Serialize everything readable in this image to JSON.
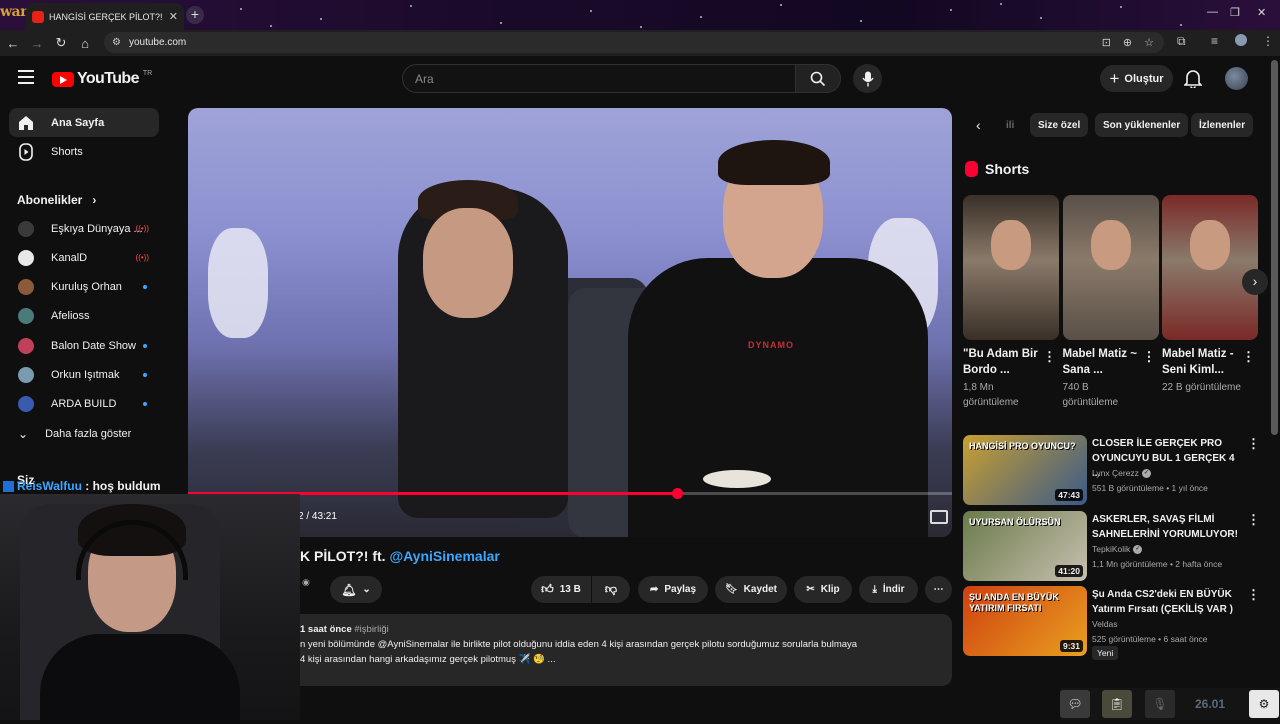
{
  "browser": {
    "tab_title": "HANGİSİ GERÇEK PİLOT?! ft. @A",
    "url": "youtube.com",
    "overlay_logo": "wanted"
  },
  "header": {
    "logo_text": "YouTube",
    "region": "TR",
    "search_placeholder": "Ara",
    "create_label": "Oluştur"
  },
  "sidebar": {
    "items": [
      {
        "label": "Ana Sayfa",
        "icon": "home-icon"
      },
      {
        "label": "Shorts",
        "icon": "shorts-icon"
      }
    ],
    "subs_heading": "Abonelikler",
    "subscriptions": [
      {
        "label": "Eşkıya Dünyaya ...",
        "color": "#3a3a3a",
        "status": "live"
      },
      {
        "label": "KanalD",
        "color": "#e8e8e8",
        "status": "live"
      },
      {
        "label": "Kuruluş Orhan",
        "color": "#8a5a3a",
        "status": "new"
      },
      {
        "label": "Afelioss",
        "color": "#4a7a7a",
        "status": ""
      },
      {
        "label": "Balon Date Show",
        "color": "#c0405a",
        "status": "new"
      },
      {
        "label": "Orkun Işıtmak",
        "color": "#7a9ab0",
        "status": "new"
      },
      {
        "label": "ARDA BUILD",
        "color": "#3a5ab0",
        "status": "new"
      }
    ],
    "show_more": "Daha fazla göster",
    "partial_section": "Siz"
  },
  "player": {
    "shirt_text": "DYNAMO",
    "timecode": "2 / 43:21",
    "progress": 0.64
  },
  "video": {
    "title_partial": "K PİLOT?! ft. ",
    "title_mention": "@AyniSinemalar",
    "like_count": "13 B",
    "share_label": "Paylaş",
    "save_label": "Kaydet",
    "clip_label": "Klip",
    "download_label": "İndir"
  },
  "description": {
    "meta": "1 saat önce",
    "hashtag": "#işbirliği",
    "line1": "n yeni bölümünde @AyniSinemalar ile birlikte pilot olduğunu iddia eden 4 kişi arasından gerçek pilotu sorduğumuz sorularla bulmaya",
    "line2": "4 kişi arasından hangi arkadaşımız gerçek pilotmuş ✈️ 🧐 ..."
  },
  "chips": [
    "ili",
    "Size özel",
    "Son yüklenenler",
    "İzlenenler"
  ],
  "shorts": {
    "heading": "Shorts",
    "items": [
      {
        "title": "\"Bu Adam Bir Bordo ...",
        "views": "1,8 Mn görüntüleme",
        "bg": "#3a3028"
      },
      {
        "title": "Mabel Matiz ~ Sana ...",
        "views": "740 B görüntüleme",
        "bg": "#5a5048"
      },
      {
        "title": "Mabel Matiz - Seni Kiml...",
        "views": "22 B görüntüleme",
        "bg": "#7a2a28"
      }
    ]
  },
  "recommended": [
    {
      "title": "CLOSER İLE GERÇEK PRO OYUNCUYU BUL 1 GERÇEK 4 ...",
      "channel": "Lynx Çerezz",
      "verified": true,
      "meta": "551 B görüntüleme • 1 yıl önce",
      "duration": "47:43",
      "thumb_text": "HANGİSİ PRO OYUNCU?",
      "badge": "",
      "colors": [
        "#c9a030",
        "#3a5a8a"
      ]
    },
    {
      "title": "ASKERLER, SAVAŞ FİLMİ SAHNELERİNİ YORUMLUYOR!",
      "channel": "TepkiKolik",
      "verified": true,
      "meta": "1,1 Mn görüntüleme • 2 hafta önce",
      "duration": "41:20",
      "thumb_text": "UYURSAN ÖLÜRSÜN",
      "badge": "",
      "colors": [
        "#6a7a4a",
        "#c8c0b0"
      ]
    },
    {
      "title": "Şu Anda CS2'deki EN BÜYÜK Yatırım Fırsatı (ÇEKİLİŞ VAR )",
      "channel": "Veldas",
      "verified": false,
      "meta": "525 görüntüleme • 6 saat önce",
      "duration": "9:31",
      "thumb_text": "ŞU ANDA EN BÜYÜK YATIRIM FIRSATI",
      "badge": "Yeni",
      "colors": [
        "#d04010",
        "#e8a020"
      ]
    }
  ],
  "webcam": {
    "chat_user": "ReisWalfuu",
    "chat_text": " : hoş buldum"
  },
  "dock": {
    "number": "26.01"
  }
}
